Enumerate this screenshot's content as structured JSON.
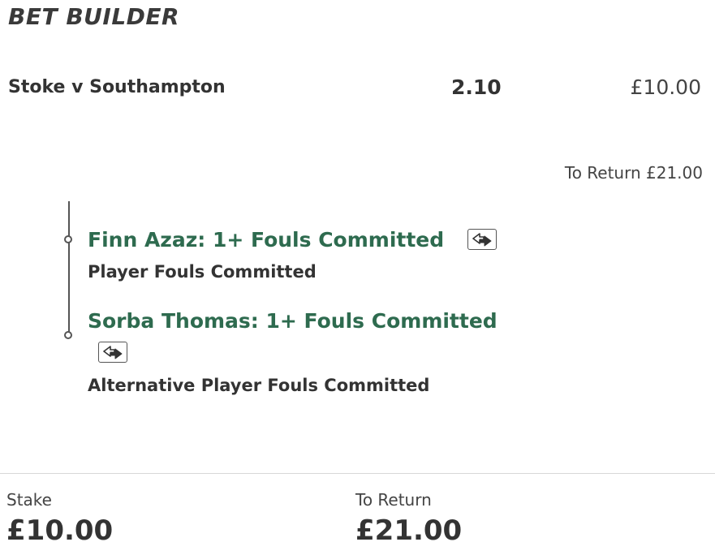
{
  "header": {
    "title": "BET BUILDER"
  },
  "bet": {
    "event": "Stoke v Southampton",
    "odds": "2.10",
    "stake": "£10.00",
    "to_return": "To Return £21.00"
  },
  "selections": [
    {
      "title": "Finn Azaz: 1+ Fouls Committed",
      "market": "Player Fouls Committed",
      "swap_icon": "swap-arrows-icon"
    },
    {
      "title": "Sorba Thomas: 1+ Fouls Committed",
      "market": "Alternative Player Fouls Committed",
      "swap_icon": "swap-arrows-icon"
    }
  ],
  "footer": {
    "stake_label": "Stake",
    "stake_value": "£10.00",
    "return_label": "To Return",
    "return_value": "£21.00"
  },
  "colors": {
    "selection_green": "#2e6b4f",
    "text_dark": "#333333"
  }
}
